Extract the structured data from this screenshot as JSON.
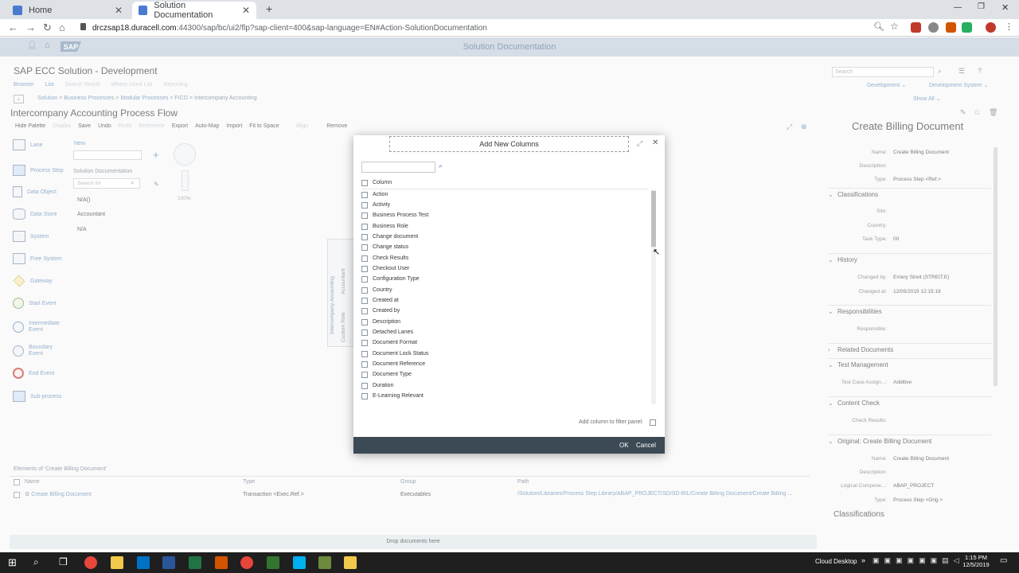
{
  "browser": {
    "tabs": [
      {
        "label": "Home"
      },
      {
        "label": "Solution Documentation"
      }
    ],
    "url_host": "drczsap18.duracell.com",
    "url_rest": ":44300/sap/bc/ui2/flp?sap-client=400&sap-language=EN#Action-SolutionDocumentation"
  },
  "shell": {
    "logo": "SAP",
    "title": "Solution Documentation"
  },
  "header": {
    "app_title": "SAP ECC Solution - Development",
    "nav_links": [
      "Browser",
      "List",
      "Search Result",
      "Where Used List",
      "Reporting"
    ],
    "search_placeholder": "Search",
    "development": "Development",
    "development_system": "Development System",
    "show_all": "Show All",
    "breadcrumb": [
      "Solution",
      "Business Processes",
      "Modular Processes",
      "FICO",
      "Intercompany Accounting"
    ]
  },
  "editor": {
    "title": "Intercompany Accounting Process Flow",
    "toolbar": [
      "Hide Palette",
      "Display",
      "Save",
      "Undo",
      "Redo",
      "Reference",
      "Export",
      "Auto-Map",
      "Import",
      "Fit to Space",
      "Align",
      "Remove"
    ],
    "palette": [
      "Lane",
      "Process Step",
      "Data Object",
      "Data Store",
      "System",
      "Free System",
      "Gateway",
      "Start Event",
      "Intermediate Event",
      "Boundary Event",
      "End Event",
      "Sub-process"
    ],
    "new_label": "New",
    "sol_doc_label": "Solution Documentation",
    "search_for": "Search for",
    "roles": [
      "N/A()",
      "Accountant",
      "N/A"
    ],
    "zoom": "100%",
    "lane_labels": [
      "Accountant",
      "Intercompany Accounting",
      "Custom Role"
    ]
  },
  "elements": {
    "heading": "Elements of 'Create Billing Document'",
    "columns": [
      "Name",
      "Type",
      "Group",
      "Path"
    ],
    "rows": [
      {
        "name": "Create Billing Document",
        "type": "Transaction <Exec.Ref.>",
        "group": "Executables",
        "path": "/Solution/Libraries/Process Step Library/ABAP_PROJECT/SD/SD-BIL/Create Billing Document/Create Billing ..."
      }
    ],
    "drop_text": "Drop documents here"
  },
  "dialog": {
    "title": "Add New Columns",
    "header_column": "Column",
    "columns": [
      "Action",
      "Activity",
      "Business Process Test",
      "Business Role",
      "Change document",
      "Change status",
      "Check Results",
      "Checkout User",
      "Configuration Type",
      "Country",
      "Created at",
      "Created by",
      "Description",
      "Detached Lanes",
      "Document Format",
      "Document Lock Status",
      "Document Reference",
      "Document Type",
      "Duration",
      "E-Learning Relevant"
    ],
    "filter_label": "Add column to filter panel:",
    "ok": "OK",
    "cancel": "Cancel"
  },
  "right_panel": {
    "title": "Create Billing Document",
    "general": [
      {
        "label": "Name:",
        "value": "Create Billing Document"
      },
      {
        "label": "Description:",
        "value": ""
      },
      {
        "label": "Type:",
        "value": "Process Step <Ref.>"
      }
    ],
    "classifications": {
      "header": "Classifications",
      "rows": [
        {
          "label": "Site:",
          "value": ""
        },
        {
          "label": "Country:",
          "value": ""
        },
        {
          "label": "Task Type:",
          "value": "00"
        }
      ]
    },
    "history": {
      "header": "History",
      "rows": [
        {
          "label": "Changed by:",
          "value": "Emery Streit (STREIT.E)"
        },
        {
          "label": "Changed at:",
          "value": "12/05/2019 12:15:19"
        }
      ]
    },
    "responsibilities": {
      "header": "Responsibilities",
      "rows": [
        {
          "label": "Responsible:",
          "value": ""
        }
      ]
    },
    "related_documents": "Related Documents",
    "test_management": {
      "header": "Test Management",
      "rows": [
        {
          "label": "Test Case Assign...:",
          "value": "Additive"
        }
      ]
    },
    "content_check": {
      "header": "Content Check",
      "rows": [
        {
          "label": "Check Results:",
          "value": ""
        }
      ]
    },
    "original": {
      "header": "Original: Create Billing Document",
      "rows": [
        {
          "label": "Name:",
          "value": "Create Billing Document"
        },
        {
          "label": "Description:",
          "value": ""
        },
        {
          "label": "Logical Compone...:",
          "value": "ABAP_PROJECT"
        },
        {
          "label": "Type:",
          "value": "Process Step <Orig.>"
        }
      ]
    },
    "classifications2": "Classifications"
  },
  "taskbar": {
    "cloud": "Cloud Desktop",
    "time": "1:15 PM",
    "date": "12/5/2019"
  },
  "colors": {
    "shell": "#d5dde6",
    "dialog_footer": "#3c4a56",
    "link": "#5b86b3",
    "taskbar": "#1f1f1f"
  }
}
